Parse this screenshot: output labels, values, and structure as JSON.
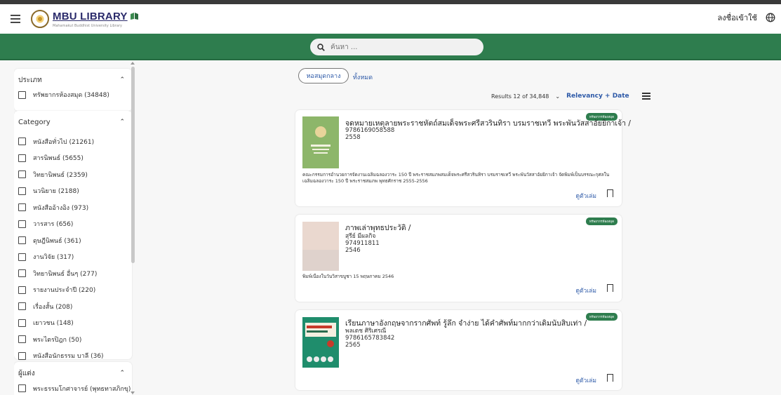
{
  "header": {
    "logo_title": "MBU LIBRARY",
    "logo_subtitle": "Mahamakut Buddhist University Library",
    "login_label": "ลงชื่อเข้าใช้"
  },
  "search": {
    "placeholder": "ค้นหา ..."
  },
  "sidebar": {
    "groups": [
      {
        "title": "ประเภท",
        "items": [
          "ทรัพยากรห้องสมุด (34848)"
        ]
      },
      {
        "title": "Category",
        "items": [
          "หนังสือทั่วไป (21261)",
          "สารนิพนธ์ (5655)",
          "วิทยานิพนธ์ (2359)",
          "นวนิยาย (2188)",
          "หนังสืออ้างอิง (973)",
          "วารสาร (656)",
          "ดุษฎีนิพนธ์ (361)",
          "งานวิจัย (317)",
          "วิทยานิพนธ์ อื่นๆ (277)",
          "รายงานประจำปี (220)",
          "เรื่องสั้น (208)",
          "เยาวชน (148)",
          "พระไตรปิฎก (50)",
          "หนังสือนักธรรม บาลี (36)"
        ]
      },
      {
        "title": "ผู้แต่ง",
        "items": [
          "พระธรรมโกศาจารย์ (พุทธทาสภิกขุ) ("
        ]
      }
    ]
  },
  "filters": {
    "library_pill": "หอสมุดกลาง",
    "all_link": "ทั้งหมด"
  },
  "results": {
    "summary": "Results 12 of 34,848",
    "sort_label": "Relevancy + Date"
  },
  "records": [
    {
      "badge": "ทรัพยากรห้องสมุด",
      "title": "จดหมายเหตุลายพระราชหัตถ์สมเด็จพระศรีสวรินทิรา บรมราชเทวี พระพันวัสสาอัยยิกาเจ้า /",
      "author": "",
      "isbn": "9786169058588",
      "year": "2558",
      "note": "คณะกรรมการอำนวยการจัดงานเฉลิมฉลองวาระ 150 ปี พระราชสมภพสมเด็จพระศรีสวรินทิรา บรมราชเทวี พระพันวัสสาอัยยิกาเจ้า จัดพิมพ์เป็นบรรณะกุศลในเฉลิมฉลองวาระ 150 ปี พระราชสมภพ พุทธศักราช 2555-2556",
      "view_label": "ดูตัวเล่ม"
    },
    {
      "badge": "ทรัพยากรห้องสมุด",
      "title": "ภาพเล่าพุทธประวัติ /",
      "author": "สุรีย์ มีผลกิจ",
      "isbn": "974911811",
      "year": "2546",
      "note": "พิมพ์เนื่องในวันวิสาขบูชา 15 พฤษภาคม 2546",
      "view_label": "ดูตัวเล่ม"
    },
    {
      "badge": "ทรัพยากรห้องสมุด",
      "title": "เรียนภาษาอังกฤษจากรากศัพท์ รู้ลึก จำง่าย ได้คำศัพท์มากกว่าเดิมนับสิบเท่า /",
      "author": "พลเดช ศิริเศรณี",
      "isbn": "9786165783842",
      "year": "2565",
      "note": "",
      "view_label": "ดูตัวเล่ม"
    }
  ],
  "colors": {
    "brand_green": "#2e7d4e",
    "link_blue": "#2e5aa8"
  }
}
